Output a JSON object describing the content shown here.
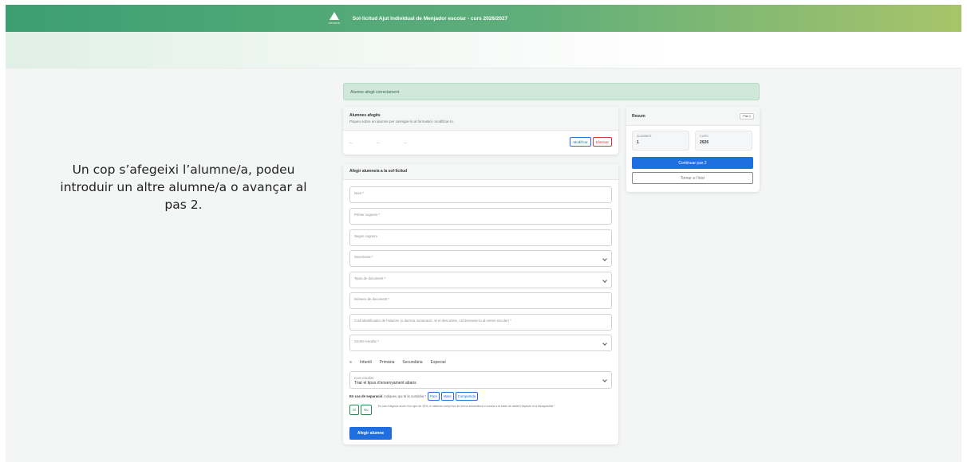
{
  "header": {
    "logo_text": "nexaria",
    "title": "Sol·licitud Ajut Individual de Menjador escolar - curs 2026/2027"
  },
  "instructions": "Un cop s’afegeixi l’alumne/a, podeu introduir un altre alumne/a o avançar al pas 2.",
  "alert": {
    "text": "Alumne afegit correctament"
  },
  "selected": {
    "title": "Alumnes afegits",
    "subtitle": "Piqueu sobre un alumne per carregar-lo al formulari i modificar-lo.",
    "row": [
      "...",
      "...",
      "..."
    ],
    "modify_label": "Modificar",
    "delete_label": "Eliminar"
  },
  "form": {
    "title": "Afegir alumne/a a la sol·licitud",
    "fields": {
      "nom": "Nom *",
      "cognom1": "Primer cognom *",
      "cognom2": "Segon cognom",
      "sexe": "Sexe/nena *",
      "doc_tipus": "Tipus de document *",
      "doc_numero": "Número de document *",
      "idalu": "Codi identificador de l’alumne (o darrera numeració. Si el desconeix, cal demanar-lo al centre escolar) *",
      "centre": "Centre escolar *",
      "curs_label": "Curs escolar",
      "curs_value": "Triar el tipus d’ensenyament abans"
    },
    "stages": [
      "Infantil",
      "Primària",
      "Secundària",
      "Especial"
    ],
    "separation": {
      "label": "En cas de separació",
      "hint": "indiqueu qui té la custòdia *",
      "options": [
        "Pare",
        "Mare",
        "Compartida"
      ]
    },
    "disability": {
      "yes": "Sí",
      "no": "No",
      "text": "En cas d’alguna acció d’un ajut de 33%, el sistema comprova de forma automàtica si consta a la base de dades respecte a la discapacitat *"
    },
    "submit_label": "Afegir alumne"
  },
  "summary": {
    "title": "Resum",
    "action_label": "Pas 1",
    "students_label": "ALUMNES",
    "students_value": "1",
    "course_label": "CURS",
    "course_value": "2026",
    "continue_label": "Continuar pas 2",
    "back_label": "Tornar a l’inici"
  },
  "colors": {
    "header_start": "#3c9f72",
    "header_end": "#a8c46a",
    "primary": "#1f6fe0",
    "danger": "#dd3333",
    "success_bg": "#cfe8d9"
  }
}
